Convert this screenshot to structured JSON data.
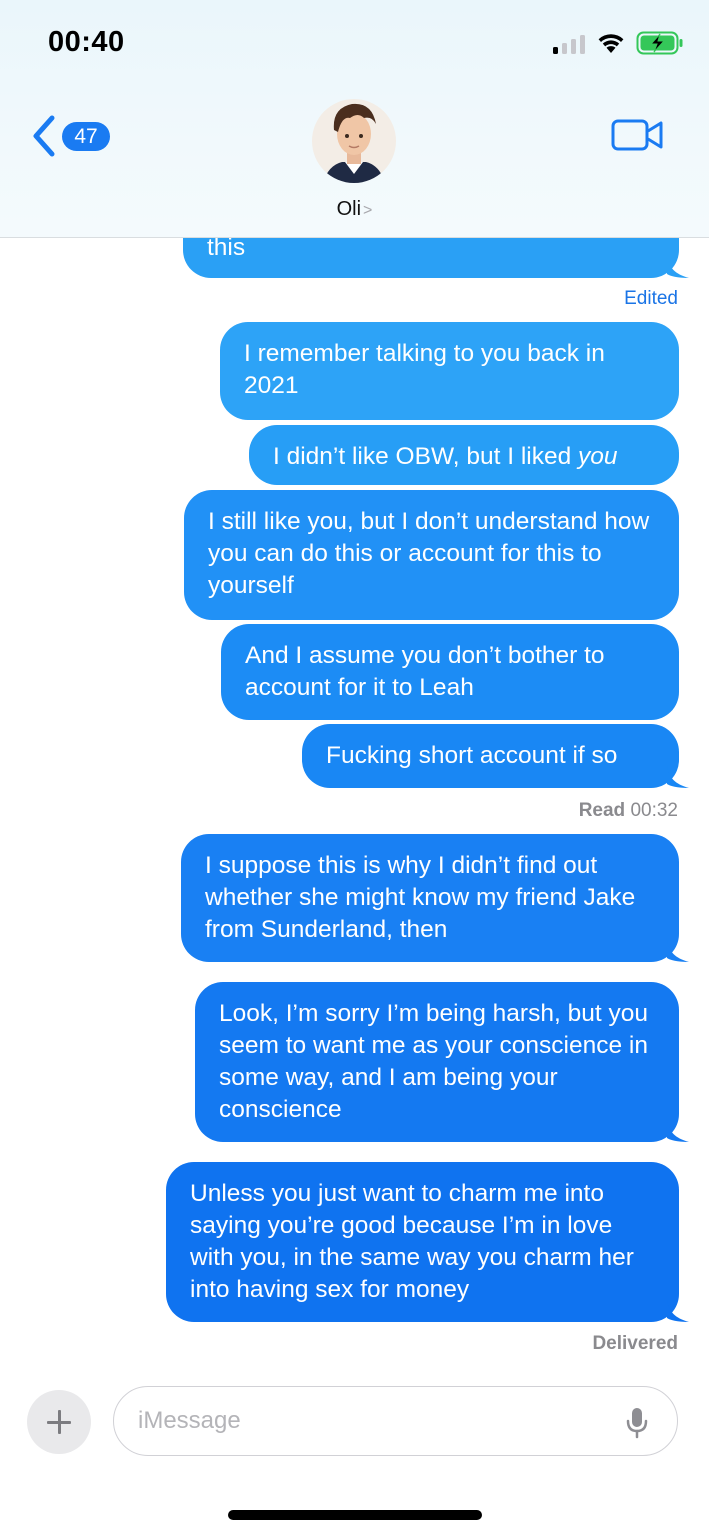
{
  "status_bar": {
    "time": "00:40"
  },
  "header": {
    "back_badge_count": "47",
    "contact_name": "Oli",
    "contact_chevron": ">"
  },
  "messages": [
    {
      "text": "this",
      "status": "Edited"
    },
    {
      "text": "I remember talking to you back in 2021"
    },
    {
      "text_before": "I didn’t like OBW, but I liked ",
      "text_italic": "you"
    },
    {
      "text": "I still like you, but I don’t understand how you can do this or account for this to yourself"
    },
    {
      "text": "And I assume you don’t bother to account for it to Leah"
    },
    {
      "text": "Fucking short account if so",
      "status_label": "Read",
      "status_time": "00:32"
    },
    {
      "text": "I suppose this is why I didn’t find out whether she might know my friend Jake from Sunderland, then"
    },
    {
      "text": "Look, I’m sorry I’m being harsh, but you seem to want me as your conscience in some way, and I am being your conscience"
    },
    {
      "text": "Unless you just want to charm me into saying you’re good because I’m in love with you, in the same way you charm her into having sex for money",
      "status": "Delivered"
    }
  ],
  "composer": {
    "placeholder": "iMessage"
  },
  "colors": {
    "accent": "#1a7bf2",
    "bubble_top": "#2da3f7",
    "bubble_bottom": "#0f73f0"
  },
  "icons": [
    "back-chevron-icon",
    "video-camera-icon",
    "plus-icon",
    "microphone-icon",
    "signal-icon",
    "wifi-icon",
    "battery-charging-icon"
  ]
}
